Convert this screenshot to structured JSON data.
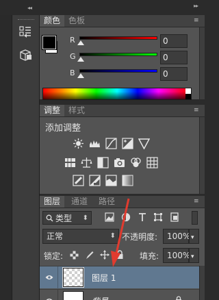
{
  "dock": {
    "collapse_glyph": "◂◂",
    "expand_glyph": "▸▸"
  },
  "color_panel": {
    "tabs": [
      "颜色",
      "色板"
    ],
    "menu_glyph": "≡",
    "channels": [
      {
        "label": "R",
        "value": "0",
        "color": "#ff0000"
      },
      {
        "label": "G",
        "value": "0",
        "color": "#00ff00"
      },
      {
        "label": "B",
        "value": "0",
        "color": "#0000ff"
      }
    ],
    "foreground_color": "#000000",
    "background_color": "#ffffff"
  },
  "adjustments_panel": {
    "tabs": [
      "调整",
      "样式"
    ],
    "title": "添加调整",
    "icons": [
      "brightness-contrast-icon",
      "levels-icon",
      "curves-icon",
      "exposure-icon",
      "vibrance-icon",
      "hue-saturation-icon",
      "color-balance-icon",
      "black-white-icon",
      "photo-filter-icon",
      "channel-mixer-icon",
      "color-lookup-icon",
      "invert-icon",
      "posterize-icon",
      "threshold-icon",
      "gradient-map-icon"
    ]
  },
  "layers_panel": {
    "tabs": [
      "图层",
      "通道",
      "路径"
    ],
    "filter_label": "类型",
    "blend_mode": "正常",
    "opacity_label": "不透明度:",
    "opacity_value": "100%",
    "lock_label": "锁定:",
    "fill_label": "填充:",
    "fill_value": "100%",
    "layers": [
      {
        "name": "图层 1",
        "selected": true
      },
      {
        "name": "背景",
        "selected": false
      }
    ]
  },
  "annotation": {
    "color": "#e03b2f"
  }
}
